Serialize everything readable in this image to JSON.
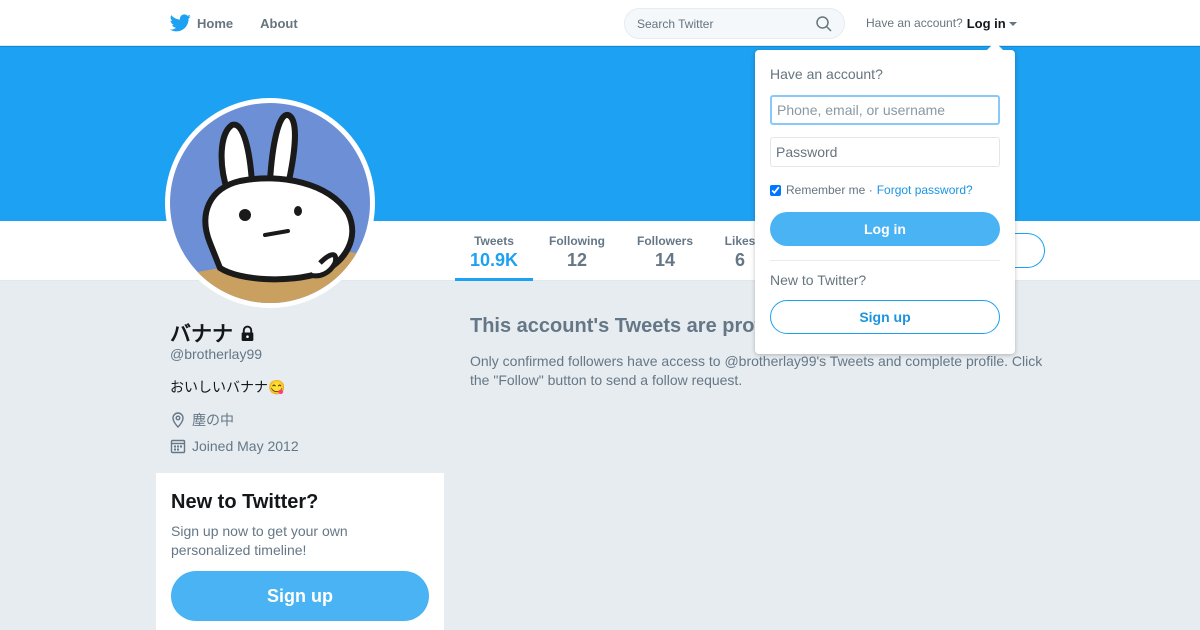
{
  "nav": {
    "home_label": "Home",
    "about_label": "About",
    "search_placeholder": "Search Twitter",
    "have_account": "Have an account?",
    "login_label": "Log in"
  },
  "profile": {
    "name": "バナナ",
    "handle": "@brotherlay99",
    "bio": "おいしいバナナ😋",
    "location": "塵の中",
    "joined": "Joined May 2012",
    "banner_color": "#1da1f2"
  },
  "stats": [
    {
      "label": "Tweets",
      "value": "10.9K"
    },
    {
      "label": "Following",
      "value": "12"
    },
    {
      "label": "Followers",
      "value": "14"
    },
    {
      "label": "Likes",
      "value": "6"
    }
  ],
  "signup_card": {
    "title": "New to Twitter?",
    "text": "Sign up now to get your own personalized timeline!",
    "button": "Sign up"
  },
  "protected": {
    "title": "This account's Tweets are protected.",
    "body": "Only confirmed followers have access to @brotherlay99's Tweets and complete profile. Click the \"Follow\" button to send a follow request."
  },
  "login_dropdown": {
    "title": "Have an account?",
    "username_placeholder": "Phone, email, or username",
    "password_placeholder": "Password",
    "remember_label": "Remember me ·",
    "forgot_label": "Forgot password?",
    "login_button": "Log in",
    "new_label": "New to Twitter?",
    "signup_button": "Sign up"
  },
  "colors": {
    "accent": "#1da1f2",
    "button": "#4ab3f4",
    "background": "#e6ecf0"
  }
}
